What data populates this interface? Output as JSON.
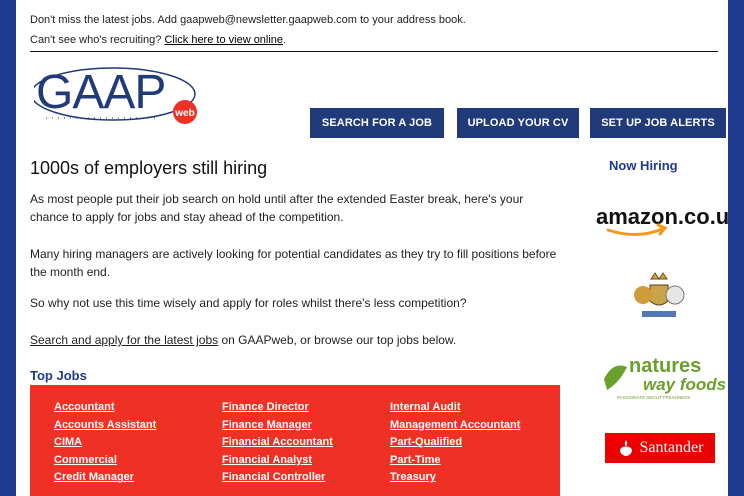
{
  "preheader": {
    "line1": "Don't miss the latest jobs. Add gaapweb@newsletter.gaapweb.com to your address book.",
    "line2_prefix": "Can't see who's recruiting? ",
    "line2_link": "Click here to view online",
    "line2_suffix": "."
  },
  "logo": {
    "text": "GAAP",
    "badge": "web",
    "colors": {
      "primary": "#213a79",
      "badge": "#ee3124"
    }
  },
  "nav": {
    "search": "SEARCH FOR A JOB",
    "upload": "UPLOAD YOUR CV",
    "alerts": "SET UP JOB ALERTS"
  },
  "main": {
    "headline": "1000s of employers still hiring",
    "p1": "As most people put their job search on hold until after the extended Easter break, here's your chance to apply for jobs and stay ahead of the competition.",
    "p2": "Many hiring managers are actively looking for potential candidates as they try to fill positions before the month end.",
    "p3": "So why not use this time wisely and apply for roles whilst there's less competition?",
    "p4_link": "Search and apply for the latest jobs",
    "p4_suffix": " on GAAPweb, or browse our top jobs below."
  },
  "top_jobs": {
    "title": "Top Jobs",
    "columns": [
      [
        "Accountant",
        "Accounts Assistant",
        "CIMA",
        "Commercial",
        "Credit Manager"
      ],
      [
        "Finance Director",
        "Finance Manager",
        "Financial Accountant",
        "Financial Analyst",
        "Financial Controller"
      ],
      [
        "Internal Audit",
        "Management Accountant",
        "Part-Qualified",
        "Part-Time",
        "Treasury"
      ]
    ]
  },
  "sidebar": {
    "title": "Now Hiring",
    "brands": {
      "amazon": "amazon.co.uk",
      "natures_top": "natures",
      "natures_bottom": "way foods",
      "natures_tagline": "PASSIONATE ABOUT FRESHNESS",
      "santander": "Santander"
    },
    "colors": {
      "amazon_orange": "#f39a1c",
      "natures_green": "#6aa12c",
      "santander_red": "#ec0000"
    }
  }
}
